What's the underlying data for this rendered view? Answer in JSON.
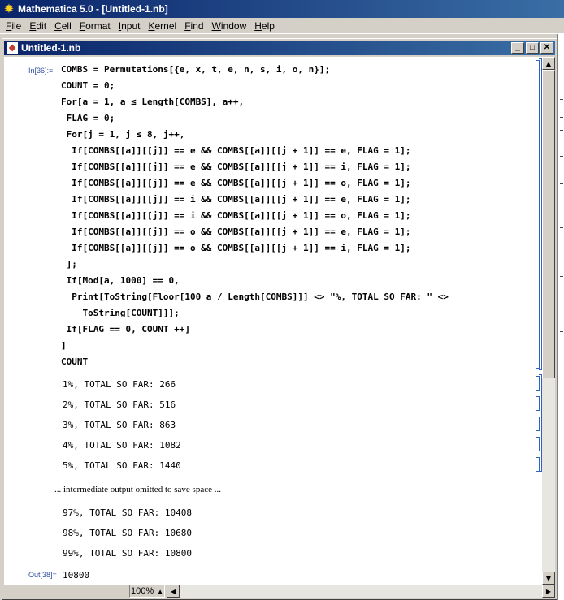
{
  "app": {
    "title": "Mathematica 5.0 - [Untitled-1.nb]"
  },
  "menu": [
    {
      "label": "File",
      "u": "F",
      "rest": "ile"
    },
    {
      "label": "Edit",
      "u": "E",
      "rest": "dit"
    },
    {
      "label": "Cell",
      "u": "C",
      "rest": "ell"
    },
    {
      "label": "Format",
      "u": "F",
      "rest": "ormat"
    },
    {
      "label": "Input",
      "u": "I",
      "rest": "nput"
    },
    {
      "label": "Kernel",
      "u": "K",
      "rest": "ernel"
    },
    {
      "label": "Find",
      "u": "F",
      "rest": "ind"
    },
    {
      "label": "Window",
      "u": "W",
      "rest": "indow"
    },
    {
      "label": "Help",
      "u": "H",
      "rest": "elp"
    }
  ],
  "notebook": {
    "title": "Untitled-1.nb",
    "buttons": {
      "minimize": "_",
      "maximize": "□",
      "close": "✕"
    },
    "input_label": "In[36]:=",
    "code_lines": [
      "COMBS = Permutations[{e, x, t, e, n, s, i, o, n}];",
      "COUNT = 0;",
      "For[a = 1, a ≤ Length[COMBS], a++,",
      " FLAG = 0;",
      " For[j = 1, j ≤ 8, j++,",
      "  If[COMBS[[a]][[j]] == e && COMBS[[a]][[j + 1]] == e, FLAG = 1];",
      "  If[COMBS[[a]][[j]] == e && COMBS[[a]][[j + 1]] == i, FLAG = 1];",
      "  If[COMBS[[a]][[j]] == e && COMBS[[a]][[j + 1]] == o, FLAG = 1];",
      "  If[COMBS[[a]][[j]] == i && COMBS[[a]][[j + 1]] == e, FLAG = 1];",
      "  If[COMBS[[a]][[j]] == i && COMBS[[a]][[j + 1]] == o, FLAG = 1];",
      "  If[COMBS[[a]][[j]] == o && COMBS[[a]][[j + 1]] == e, FLAG = 1];",
      "  If[COMBS[[a]][[j]] == o && COMBS[[a]][[j + 1]] == i, FLAG = 1];",
      " ];",
      " If[Mod[a, 1000] == 0,",
      "  Print[ToString[Floor[100 a / Length[COMBS]]] <> \"%, TOTAL SO FAR: \" <>",
      "    ToString[COUNT]]];",
      " If[FLAG == 0, COUNT ++]",
      "]",
      "COUNT"
    ],
    "print_lines_a": [
      "1%, TOTAL SO FAR: 266",
      "2%, TOTAL SO FAR: 516",
      "3%, TOTAL SO FAR: 863",
      "4%, TOTAL SO FAR: 1082",
      "5%, TOTAL SO FAR: 1440"
    ],
    "note": "... intermediate output omitted to save space ...",
    "print_lines_b": [
      "97%, TOTAL SO FAR: 10408",
      "98%, TOTAL SO FAR: 10680",
      "99%, TOTAL SO FAR: 10800"
    ],
    "output_label": "Out[38]=",
    "output_value": "10800"
  },
  "status": {
    "zoom": "100%"
  }
}
